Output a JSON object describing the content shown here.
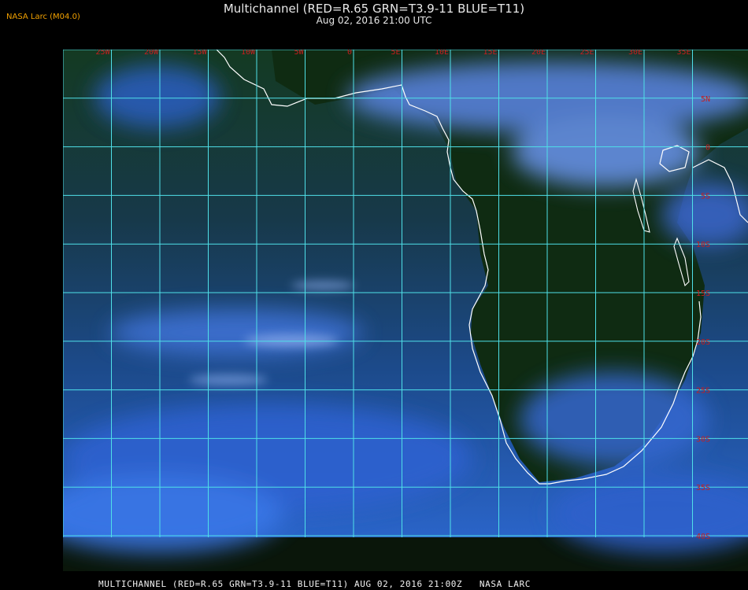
{
  "header": {
    "logo_text": "NASA Larc (M04.0)",
    "title": "Multichannel (RED=R.65 GRN=T3.9-11 BLUE=T11)",
    "subtitle": "Aug 02, 2016 21:00 UTC"
  },
  "footer": {
    "caption": "MULTICHANNEL (RED=R.65 GRN=T3.9-11 BLUE=T11) AUG 02, 2016 21:00Z   NASA LARC"
  },
  "map": {
    "longitude_labels": [
      "25W",
      "20W",
      "15W",
      "10W",
      "5W",
      "0",
      "5E",
      "10E",
      "15E",
      "20E",
      "25E",
      "30E",
      "35E"
    ],
    "latitude_labels": [
      "5N",
      "0",
      "5S",
      "10S",
      "15S",
      "20S",
      "25S",
      "30S",
      "35S",
      "40S"
    ],
    "colors": {
      "grid": "#4fe0e8",
      "coastline": "#ffffff",
      "grid_label": "#c81e1e",
      "logo": "#f0a000",
      "land": "#0f2a10",
      "ocean_clear": "#16385a",
      "cloud": "#3a6cd8"
    }
  }
}
